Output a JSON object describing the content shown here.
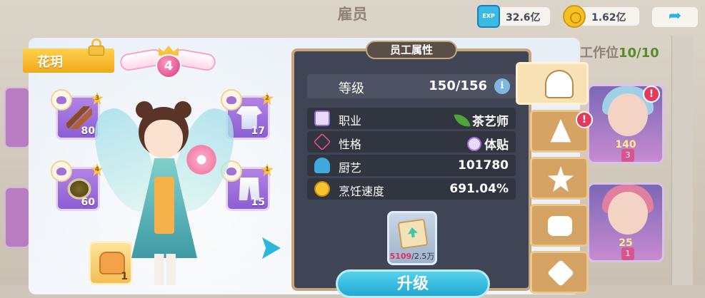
{
  "screen": {
    "title": "雇员"
  },
  "background": {
    "workpos_label": "工作位",
    "workpos_value": "10/10",
    "cards": [
      {
        "level": "140",
        "stars": "3"
      },
      {
        "level": "25",
        "stars": "1"
      }
    ]
  },
  "currency": {
    "exp": {
      "icon": "exp-icon",
      "value": "32.6亿"
    },
    "coin": {
      "icon": "coin-icon",
      "value": "1.62亿"
    }
  },
  "employee": {
    "name": "花玥",
    "rank": "4",
    "equipment": [
      {
        "slot": "tool",
        "count": "80",
        "star": "3"
      },
      {
        "slot": "ingredient",
        "count": "60",
        "star": "4"
      },
      {
        "slot": "top",
        "count": "17",
        "star": "2"
      },
      {
        "slot": "bottom",
        "count": "15",
        "star": "1"
      },
      {
        "slot": "bag",
        "count": "1"
      }
    ]
  },
  "attributes": {
    "header": "员工属性",
    "level_label": "等级",
    "level_value": "150/156",
    "rows": [
      {
        "label": "职业",
        "value": "茶艺师"
      },
      {
        "label": "性格",
        "value": "体贴"
      },
      {
        "label": "厨艺",
        "value": "101780"
      },
      {
        "label": "烹饪速度",
        "value": "691.04%"
      }
    ]
  },
  "upgrade": {
    "item_current": "5109",
    "item_required": "/2.5万",
    "button_label": "升级"
  },
  "tabs": [
    "chef-hat",
    "wizard-hat",
    "star",
    "treasure-box",
    "s-badge"
  ],
  "colors": {
    "accent": "#2bb7dd",
    "panel_border": "#c7a57a",
    "panel_bg": "#3f4554",
    "name_tag": "#f5b72e"
  }
}
